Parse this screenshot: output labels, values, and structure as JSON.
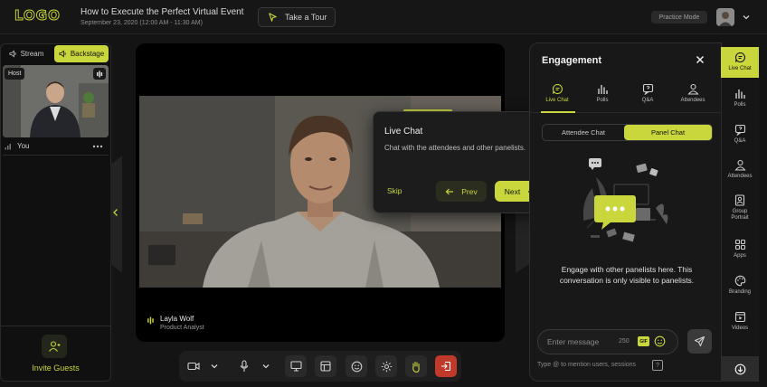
{
  "header": {
    "logo": "LOGO",
    "event_title": "How to Execute the Perfect Virtual Event",
    "event_date": "September 23, 2020 (12:00 AM - 11:30 AM)",
    "tour_label": "Take a Tour",
    "practice_label": "Practice Mode"
  },
  "left_panel": {
    "stream_label": "Stream",
    "backstage_label": "Backstage",
    "host_tag": "Host",
    "you_label": "You",
    "invite_label": "Invite Guests"
  },
  "stage": {
    "speaker_name": "Layla Wolf",
    "speaker_role": "Product Analyst"
  },
  "tour_popover": {
    "title": "Live Chat",
    "description": "Chat with the attendees and other panelists.",
    "skip_label": "Skip",
    "prev_label": "Prev",
    "next_label": "Next"
  },
  "engagement": {
    "title": "Engagement",
    "tabs": [
      {
        "label": "Live Chat",
        "icon": "chat-icon",
        "active": true
      },
      {
        "label": "Polls",
        "icon": "polls-icon"
      },
      {
        "label": "Q&A",
        "icon": "qa-icon"
      },
      {
        "label": "Attendees",
        "icon": "attendees-icon"
      }
    ],
    "chat_tabs": {
      "attendee": "Attendee Chat",
      "panel": "Panel Chat"
    },
    "empty_text": "Engage with other panelists here. This conversation is only visible to panelists.",
    "message_placeholder": "Enter message",
    "char_count": "250",
    "gif_label": "GIF",
    "hint": "Type @ to mention users, sessions",
    "hint_help": "?"
  },
  "rail": {
    "items": [
      {
        "label": "Live Chat",
        "icon": "chat-icon"
      },
      {
        "label": "Polls",
        "icon": "polls-icon"
      },
      {
        "label": "Q&A",
        "icon": "qa-icon"
      },
      {
        "label": "Attendees",
        "icon": "attendees-icon"
      },
      {
        "label": "Group Portrait",
        "icon": "portrait-icon"
      },
      {
        "label": "Apps",
        "icon": "apps-icon"
      },
      {
        "label": "Branding",
        "icon": "palette-icon"
      },
      {
        "label": "Videos",
        "icon": "video-icon"
      }
    ]
  },
  "colors": {
    "accent": "#c9d63c",
    "background": "#141414",
    "panel": "#181818",
    "end_call": "#c0392b"
  }
}
